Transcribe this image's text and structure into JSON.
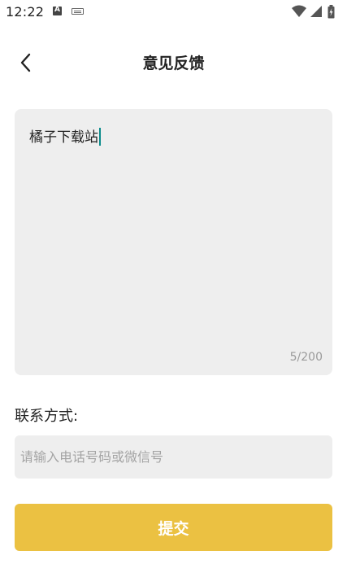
{
  "status_bar": {
    "time": "12:22",
    "notification_icon_letter": "A",
    "icons": [
      "a-notification-icon",
      "keyboard-icon",
      "wifi-icon",
      "signal-icon",
      "battery-icon"
    ]
  },
  "header": {
    "title": "意见反馈",
    "back_icon": "chevron-left-icon"
  },
  "feedback": {
    "value": "橘子下载站",
    "counter": "5/200"
  },
  "contact": {
    "label": "联系方式:",
    "placeholder": "请输入电话号码或微信号",
    "value": ""
  },
  "submit": {
    "label": "提交"
  },
  "colors": {
    "accent": "#ebc142",
    "field_background": "#eeeeee",
    "cursor": "#0a8b8b",
    "text": "#222222",
    "muted_text": "#9a9a9a"
  }
}
